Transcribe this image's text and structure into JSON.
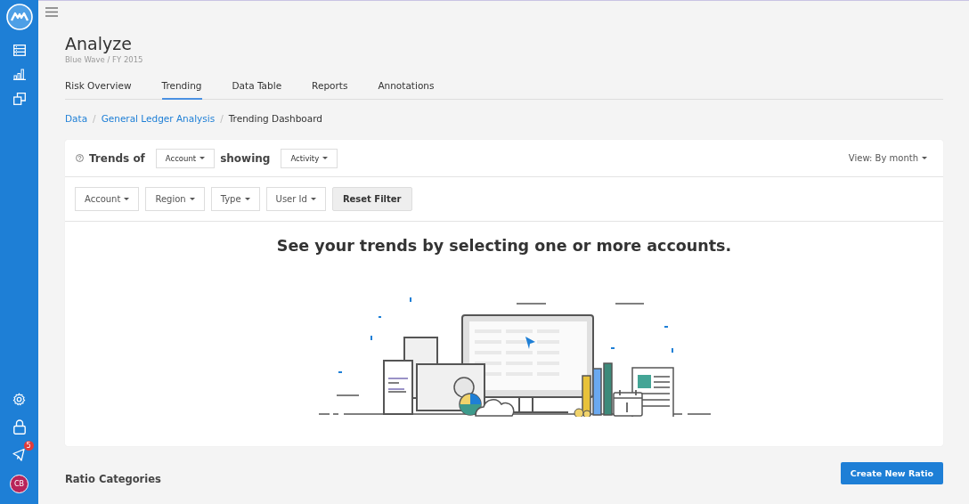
{
  "sidebar": {
    "top_items": [
      {
        "kind": "list"
      },
      {
        "kind": "chart"
      },
      {
        "kind": "windows"
      }
    ],
    "bottom_items": [
      {
        "kind": "settings"
      },
      {
        "kind": "lock"
      },
      {
        "kind": "announce",
        "badge": "5"
      },
      {
        "kind": "avatar",
        "initials": "CB"
      }
    ]
  },
  "page": {
    "title": "Analyze",
    "subtitle": "Blue Wave / FY 2015"
  },
  "tabs": [
    {
      "label": "Risk Overview",
      "selected": false
    },
    {
      "label": "Trending",
      "selected": true
    },
    {
      "label": "Data Table",
      "selected": false
    },
    {
      "label": "Reports",
      "selected": false
    },
    {
      "label": "Annotations",
      "selected": false
    }
  ],
  "breadcrumb": [
    {
      "kind": "link",
      "label": "Data"
    },
    {
      "kind": "separator",
      "label": "/"
    },
    {
      "kind": "link",
      "label": "General Ledger Analysis"
    },
    {
      "kind": "separator",
      "label": "/"
    },
    {
      "kind": "current",
      "label": "Trending Dashboard"
    }
  ],
  "trends": {
    "label": "Trends of",
    "dimension": "Account",
    "connector": "showing",
    "measure": "Activity",
    "view": "View: By month"
  },
  "filters": [
    "Account",
    "Region",
    "Type",
    "User Id"
  ],
  "reset_button": "Reset Filter",
  "empty_message": "See your trends by selecting one or more accounts.",
  "ratio_section": {
    "title": "Ratio Categories",
    "button": "Create New Ratio"
  }
}
